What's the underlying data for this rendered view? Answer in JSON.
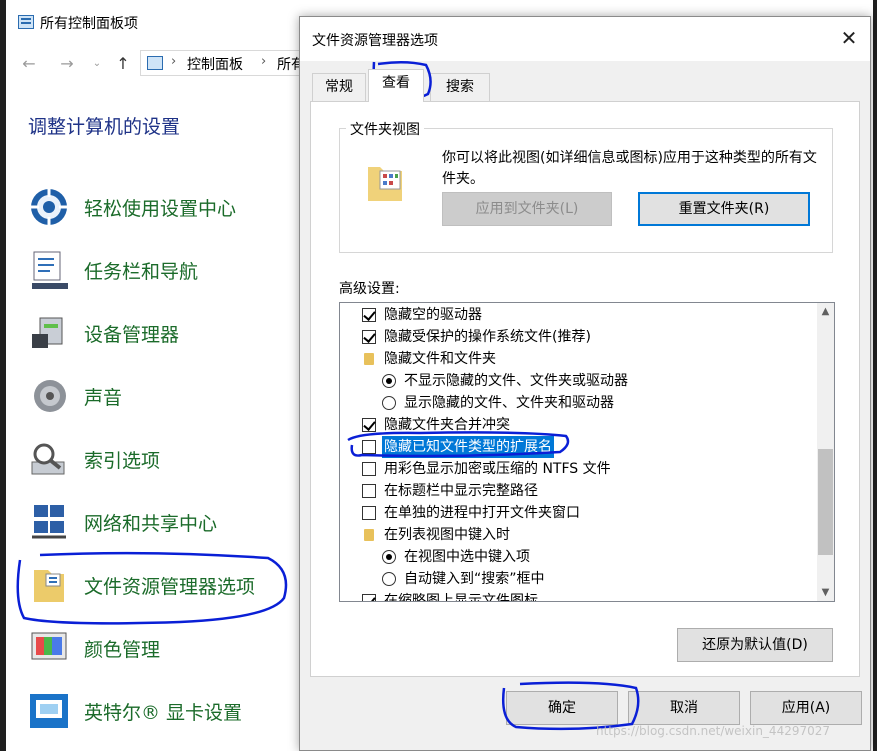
{
  "control_panel": {
    "title": "所有控制面板项",
    "breadcrumb": [
      "控制面板",
      "所有"
    ],
    "heading": "调整计算机的设置",
    "items": [
      {
        "label": "轻松使用设置中心",
        "icon": "ease-of-access-icon"
      },
      {
        "label": "任务栏和导航",
        "icon": "taskbar-icon"
      },
      {
        "label": "设备管理器",
        "icon": "device-manager-icon"
      },
      {
        "label": "声音",
        "icon": "speaker-icon"
      },
      {
        "label": "索引选项",
        "icon": "indexing-icon"
      },
      {
        "label": "网络和共享中心",
        "icon": "network-icon"
      },
      {
        "label": "文件资源管理器选项",
        "icon": "folder-options-icon"
      },
      {
        "label": "颜色管理",
        "icon": "color-management-icon"
      },
      {
        "label": "英特尔® 显卡设置",
        "icon": "intel-graphics-icon"
      }
    ]
  },
  "dialog": {
    "title": "文件资源管理器选项",
    "tabs": [
      "常规",
      "查看",
      "搜索"
    ],
    "active_tab": "查看",
    "folder_views": {
      "legend": "文件夹视图",
      "description": "你可以将此视图(如详细信息或图标)应用于这种类型的所有文件夹。",
      "apply_button": "应用到文件夹(L)",
      "reset_button": "重置文件夹(R)"
    },
    "advanced_label": "高级设置:",
    "advanced_items": [
      {
        "type": "checkbox",
        "checked": true,
        "label": "隐藏空的驱动器",
        "indent": 1
      },
      {
        "type": "checkbox",
        "checked": true,
        "label": "隐藏受保护的操作系统文件(推荐)",
        "indent": 1
      },
      {
        "type": "folder",
        "label": "隐藏文件和文件夹",
        "indent": 1
      },
      {
        "type": "radio",
        "checked": true,
        "label": "不显示隐藏的文件、文件夹或驱动器",
        "indent": 2
      },
      {
        "type": "radio",
        "checked": false,
        "label": "显示隐藏的文件、文件夹和驱动器",
        "indent": 2
      },
      {
        "type": "checkbox",
        "checked": true,
        "label": "隐藏文件夹合并冲突",
        "indent": 1
      },
      {
        "type": "checkbox",
        "checked": false,
        "label": "隐藏已知文件类型的扩展名",
        "indent": 1,
        "selected": true
      },
      {
        "type": "checkbox",
        "checked": false,
        "label": "用彩色显示加密或压缩的 NTFS 文件",
        "indent": 1
      },
      {
        "type": "checkbox",
        "checked": false,
        "label": "在标题栏中显示完整路径",
        "indent": 1
      },
      {
        "type": "checkbox",
        "checked": false,
        "label": "在单独的进程中打开文件夹窗口",
        "indent": 1
      },
      {
        "type": "folder",
        "label": "在列表视图中键入时",
        "indent": 1
      },
      {
        "type": "radio",
        "checked": true,
        "label": "在视图中选中键入项",
        "indent": 2
      },
      {
        "type": "radio",
        "checked": false,
        "label": "自动键入到“搜索”框中",
        "indent": 2
      },
      {
        "type": "checkbox",
        "checked": true,
        "label": "在缩略图上显示文件图标",
        "indent": 1
      }
    ],
    "restore_defaults_button": "还原为默认值(D)",
    "ok_button": "确定",
    "cancel_button": "取消",
    "apply_button": "应用(A)"
  },
  "watermark": "https://blog.csdn.net/weixin_44297027",
  "colors": {
    "link_green": "#1b6b2a",
    "heading_blue": "#1e3287",
    "selection": "#0078d7",
    "ink": "#0a1fd6"
  }
}
